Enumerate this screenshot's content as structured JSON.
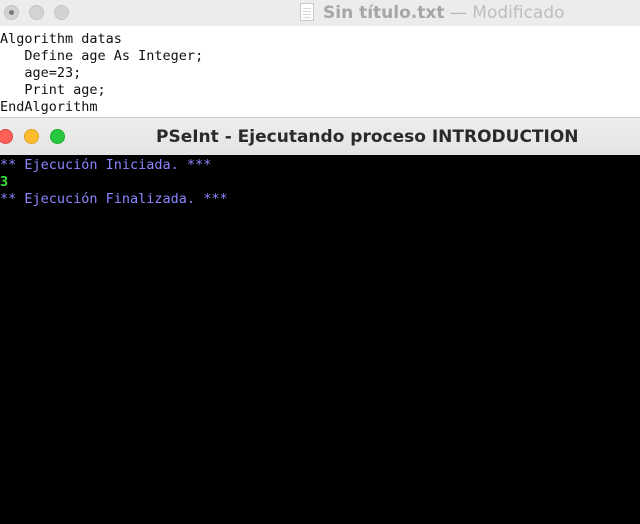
{
  "editor": {
    "window_title": "Sin título.txt",
    "title_separator": "—",
    "status": "Modificado",
    "code_lines": [
      "Algorithm datas",
      "   Define age As Integer;",
      "   age=23;",
      "   Print age;",
      "EndAlgorithm"
    ]
  },
  "console": {
    "window_title": "PSeInt - Ejecutando proceso INTRODUCTION",
    "lines": [
      "** Ejecución Iniciada. ***",
      "3",
      "** Ejecución Finalizada. ***"
    ]
  },
  "colors": {
    "close": "#fe5f57",
    "minimize": "#febc2e",
    "zoom": "#28c840",
    "console_info_text": "#8c86ff",
    "console_output_text": "#34e03a"
  },
  "icons": [
    "close-icon",
    "minimize-icon",
    "zoom-icon",
    "text-document-icon"
  ]
}
